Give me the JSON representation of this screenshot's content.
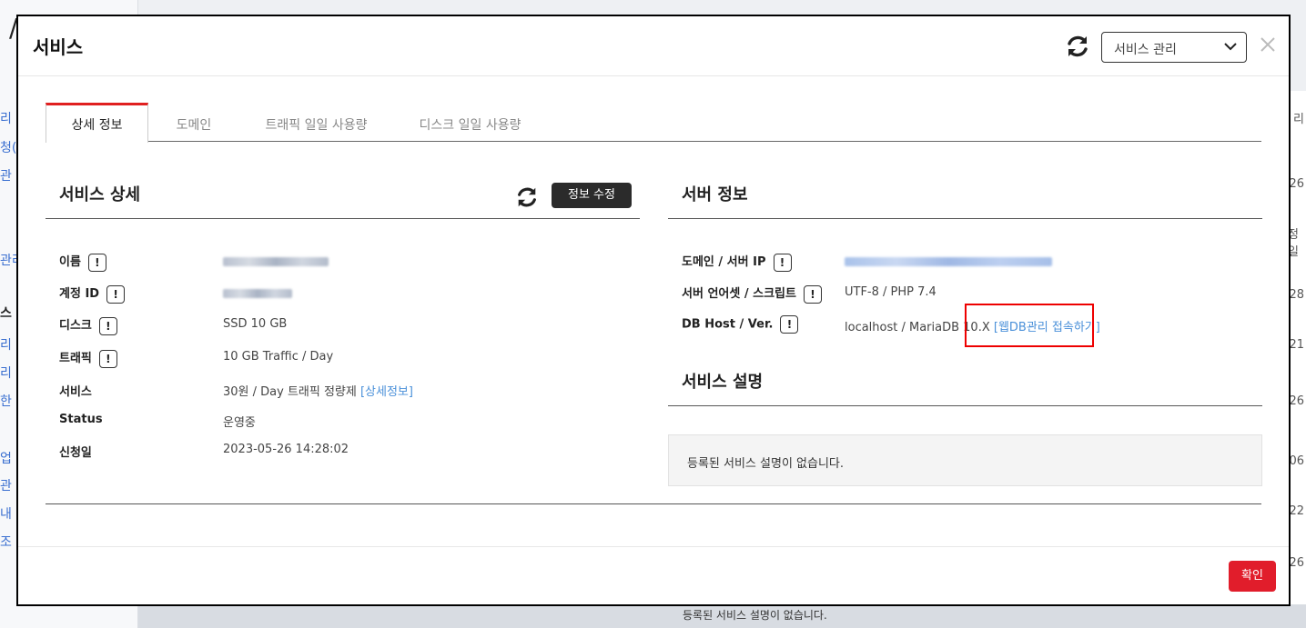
{
  "background": {
    "page_title_partial": "/",
    "left_items": [
      "리",
      "청(",
      "관",
      "관리",
      "스",
      "리",
      "리",
      "한",
      "업",
      "관",
      "내",
      "조"
    ],
    "right_values": [
      "리",
      "26",
      "정일",
      "28",
      "21",
      "26",
      "06",
      "22",
      "26"
    ],
    "bottom_text": "등록된 서비스 설명이 없습니다."
  },
  "modal": {
    "title": "서비스",
    "select": {
      "value": "서비스 관리"
    },
    "tabs": [
      {
        "label": "상세 정보",
        "active": true
      },
      {
        "label": "도메인",
        "active": false
      },
      {
        "label": "트래픽 일일 사용량",
        "active": false
      },
      {
        "label": "디스크 일일 사용량",
        "active": false
      }
    ],
    "service_detail": {
      "title": "서비스 상세",
      "edit_button": "정보 수정",
      "rows": [
        {
          "label": "이름",
          "value": "",
          "blurred": true,
          "info": true
        },
        {
          "label": "계정 ID",
          "value": "",
          "blurred": true,
          "info": true
        },
        {
          "label": "디스크",
          "value": "SSD 10 GB",
          "info": true
        },
        {
          "label": "트래픽",
          "value": "10 GB Traffic / Day",
          "info": true
        },
        {
          "label": "서비스",
          "value": "30원 / Day 트래픽 정량제 ",
          "link": "[상세정보]",
          "info": false
        },
        {
          "label": "Status",
          "value": "운영중",
          "info": false
        },
        {
          "label": "신청일",
          "value": "2023-05-26 14:28:02",
          "info": false
        }
      ]
    },
    "server_info": {
      "title": "서버 정보",
      "rows": [
        {
          "label": "도메인 / 서버 IP",
          "value": "",
          "blurred": true,
          "info": true
        },
        {
          "label": "서버 언어셋 / 스크립트",
          "value": "UTF-8 / PHP 7.4",
          "info": true
        },
        {
          "label": "DB Host / Ver.",
          "value": "localhost / MariaDB 10.X ",
          "link": "[웹DB관리 접속하기]",
          "info": true
        }
      ]
    },
    "service_description": {
      "title": "서비스 설명",
      "text": "등록된 서비스 설명이 없습니다."
    },
    "confirm_button": "확인",
    "info_mark": "!"
  },
  "colors": {
    "accent_red": "#e11d2b",
    "link_blue": "#4a90d9",
    "highlight_red": "#ee0000",
    "dark_button": "#2b2b2b"
  }
}
